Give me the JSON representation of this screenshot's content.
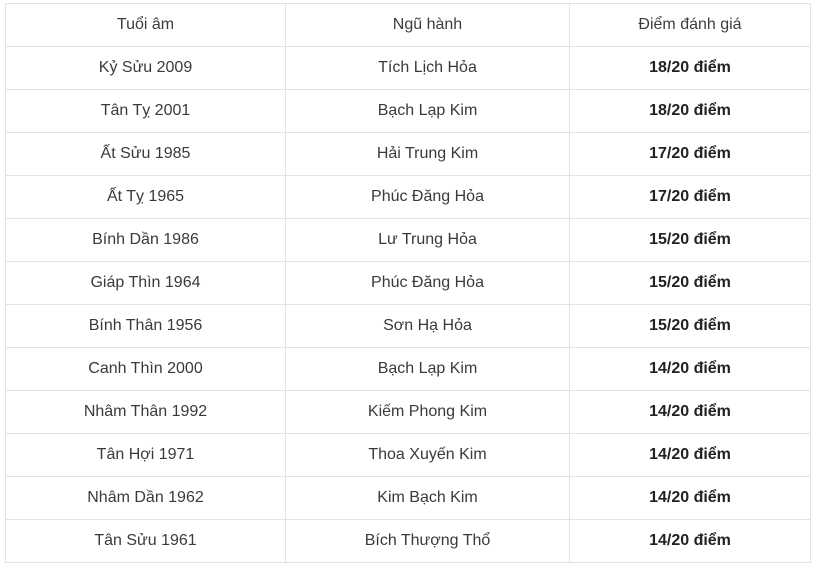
{
  "table": {
    "headers": [
      "Tuổi âm",
      "Ngũ hành",
      "Điểm đánh giá"
    ],
    "rows": [
      [
        "Kỷ Sửu 2009",
        "Tích Lịch Hỏa",
        "18/20 điểm"
      ],
      [
        "Tân Tỵ 2001",
        "Bạch Lạp Kim",
        "18/20 điểm"
      ],
      [
        "Ất Sửu 1985",
        "Hải Trung Kim",
        "17/20 điểm"
      ],
      [
        "Ất Tỵ 1965",
        "Phúc Đăng Hỏa",
        "17/20 điểm"
      ],
      [
        "Bính Dần 1986",
        "Lư Trung Hỏa",
        "15/20 điểm"
      ],
      [
        "Giáp Thìn 1964",
        "Phúc Đăng Hỏa",
        "15/20 điểm"
      ],
      [
        "Bính Thân 1956",
        "Sơn Hạ Hỏa",
        "15/20 điểm"
      ],
      [
        "Canh Thìn 2000",
        "Bạch Lạp Kim",
        "14/20 điểm"
      ],
      [
        "Nhâm Thân 1992",
        "Kiếm Phong Kim",
        "14/20 điểm"
      ],
      [
        "Tân Hợi 1971",
        "Thoa Xuyến Kim",
        "14/20 điểm"
      ],
      [
        "Nhâm Dần 1962",
        "Kim Bạch Kim",
        "14/20 điểm"
      ],
      [
        "Tân Sửu 1961",
        "Bích Thượng Thổ",
        "14/20 điểm"
      ]
    ]
  }
}
